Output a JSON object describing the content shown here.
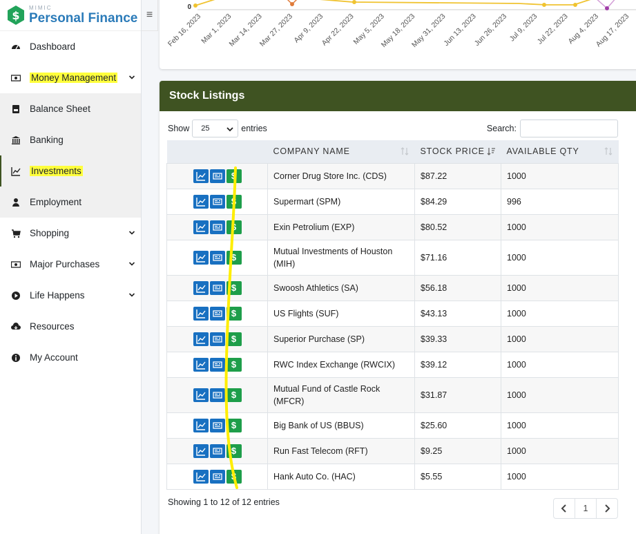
{
  "brand": {
    "mimic": "MIMIC",
    "name": "Personal Finance"
  },
  "nav": [
    {
      "label": "Dashboard",
      "icon": "dashboard-icon"
    },
    {
      "label": "Money Management",
      "icon": "money-icon",
      "expandable": true,
      "highlighted": true
    },
    {
      "label": "Balance Sheet",
      "icon": "balance-sheet-icon",
      "sub": true
    },
    {
      "label": "Banking",
      "icon": "bank-icon",
      "sub": true
    },
    {
      "label": "Investments",
      "icon": "chart-line-icon",
      "sub": true,
      "active": true,
      "highlighted": true
    },
    {
      "label": "Employment",
      "icon": "user-icon",
      "sub": true
    },
    {
      "label": "Shopping",
      "icon": "cart-icon",
      "expandable": true
    },
    {
      "label": "Major Purchases",
      "icon": "money-icon",
      "expandable": true
    },
    {
      "label": "Life Happens",
      "icon": "play-circle-icon",
      "expandable": true
    },
    {
      "label": "Resources",
      "icon": "cloud-icon"
    },
    {
      "label": "My Account",
      "icon": "info-icon"
    }
  ],
  "chart": {
    "y_tick": "0",
    "x_ticks": [
      "Feb 16, 2023",
      "Mar 1, 2023",
      "Mar 14, 2023",
      "Mar 27, 2023",
      "Apr 9, 2023",
      "Apr 22, 2023",
      "May 5, 2023",
      "May 18, 2023",
      "May 31, 2023",
      "Jun 13, 2023",
      "Jun 26, 2023",
      "Jul 9, 2023",
      "Jul 22, 2023",
      "Aug 4, 2023",
      "Aug 17, 2023"
    ]
  },
  "stock": {
    "title": "Stock Listings",
    "show_label": "Show",
    "entries_value": "25",
    "entries_label": "entries",
    "search_label": "Search:",
    "columns": [
      "",
      "Company Name",
      "Stock Price",
      "Available Qty"
    ],
    "rows": [
      {
        "company": "Corner Drug Store Inc. (CDS)",
        "price": "$87.22",
        "qty": "1000"
      },
      {
        "company": "Supermart (SPM)",
        "price": "$84.29",
        "qty": "996"
      },
      {
        "company": "Exin Petrolium (EXP)",
        "price": "$80.52",
        "qty": "1000"
      },
      {
        "company": "Mutual Investments of Houston (MIH)",
        "price": "$71.16",
        "qty": "1000"
      },
      {
        "company": "Swoosh Athletics (SA)",
        "price": "$56.18",
        "qty": "1000"
      },
      {
        "company": "US Flights (SUF)",
        "price": "$43.13",
        "qty": "1000"
      },
      {
        "company": "Superior Purchase (SP)",
        "price": "$39.33",
        "qty": "1000"
      },
      {
        "company": "RWC Index Exchange (RWCIX)",
        "price": "$39.12",
        "qty": "1000"
      },
      {
        "company": "Mutual Fund of Castle Rock (MFCR)",
        "price": "$31.87",
        "qty": "1000"
      },
      {
        "company": "Big Bank of US (BBUS)",
        "price": "$25.60",
        "qty": "1000"
      },
      {
        "company": "Run Fast Telecom (RFT)",
        "price": "$9.25",
        "qty": "1000"
      },
      {
        "company": "Hank Auto Co. (HAC)",
        "price": "$5.55",
        "qty": "1000"
      }
    ],
    "footer": "Showing 1 to 12 of 12 entries",
    "page": "1",
    "dollar_glyph": "$"
  },
  "colors": {
    "header": "#3f5322",
    "blue_btn": "#1870c1",
    "green_btn": "#1e9e4a",
    "highlight": "#ffff3c"
  }
}
